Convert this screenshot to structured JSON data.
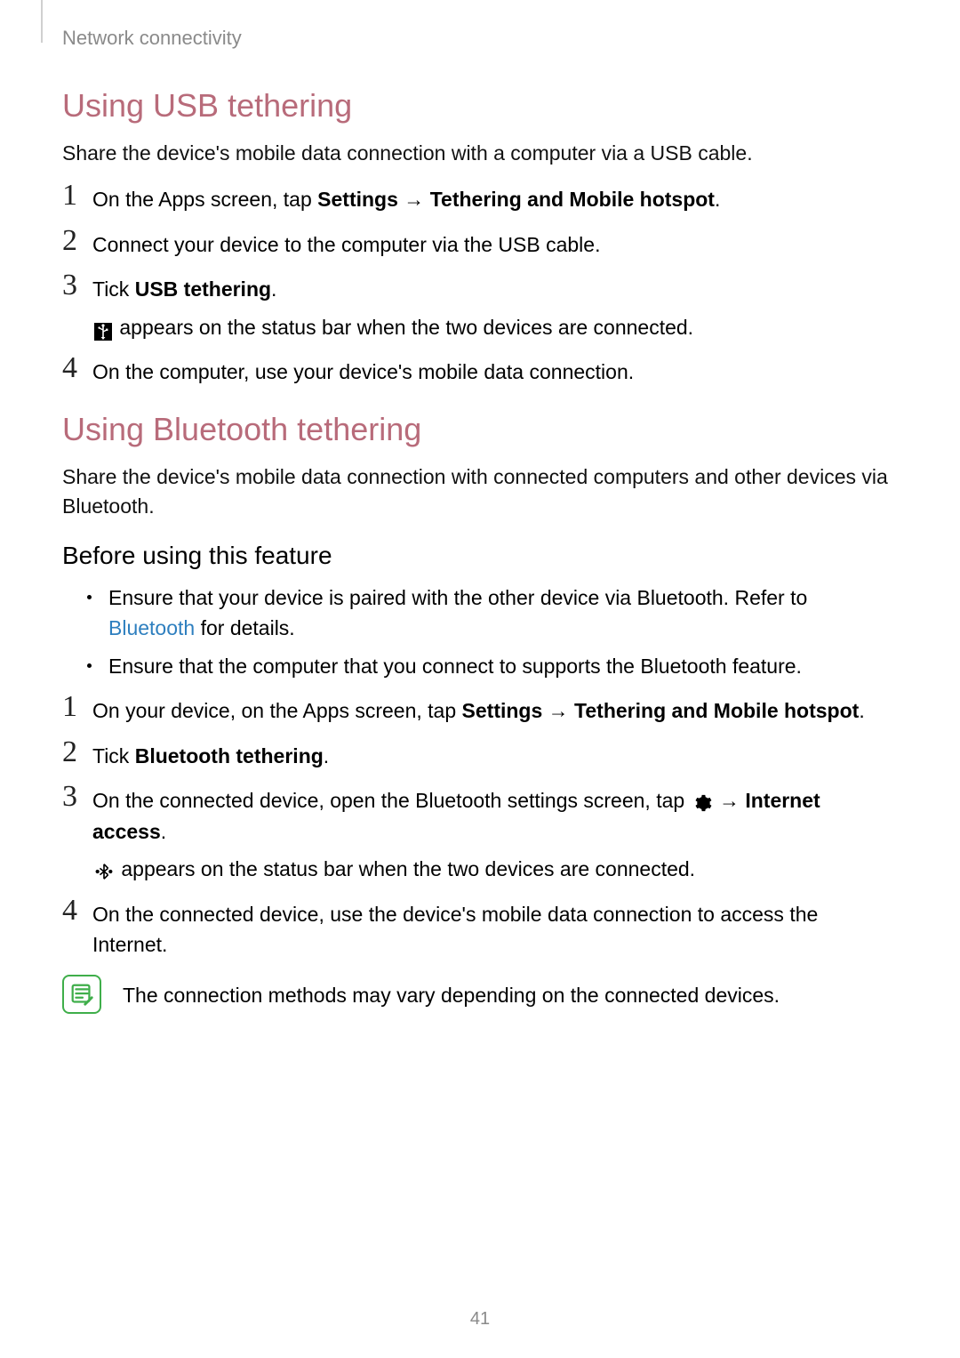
{
  "page_number": "41",
  "breadcrumb": "Network connectivity",
  "section_usb": {
    "heading": "Using USB tethering",
    "intro": "Share the device's mobile data connection with a computer via a USB cable.",
    "steps": {
      "s1": {
        "num": "1",
        "pre": "On the Apps screen, tap ",
        "b1": "Settings",
        "arrow": " → ",
        "b2": "Tethering and Mobile hotspot",
        "post": "."
      },
      "s2": {
        "num": "2",
        "text": "Connect your device to the computer via the USB cable."
      },
      "s3": {
        "num": "3",
        "pre": "Tick ",
        "b1": "USB tethering",
        "post": ".",
        "sub_post": " appears on the status bar when the two devices are connected."
      },
      "s4": {
        "num": "4",
        "text": "On the computer, use your device's mobile data connection."
      }
    }
  },
  "section_bt": {
    "heading": "Using Bluetooth tethering",
    "intro": "Share the device's mobile data connection with connected computers and other devices via Bluetooth.",
    "subheading": "Before using this feature",
    "bullets": {
      "b1": {
        "pre": "Ensure that your device is paired with the other device via Bluetooth. Refer to ",
        "link": "Bluetooth",
        "post": " for details."
      },
      "b2": {
        "text": "Ensure that the computer that you connect to supports the Bluetooth feature."
      }
    },
    "steps": {
      "s1": {
        "num": "1",
        "pre": "On your device, on the Apps screen, tap ",
        "b1": "Settings",
        "arrow": " → ",
        "b2": "Tethering and Mobile hotspot",
        "post": "."
      },
      "s2": {
        "num": "2",
        "pre": "Tick ",
        "b1": "Bluetooth tethering",
        "post": "."
      },
      "s3": {
        "num": "3",
        "pre": "On the connected device, open the Bluetooth settings screen, tap ",
        "arrow": " → ",
        "b1": "Internet access",
        "post": ".",
        "sub_post": " appears on the status bar when the two devices are connected."
      },
      "s4": {
        "num": "4",
        "text": "On the connected device, use the device's mobile data connection to access the Internet."
      }
    },
    "note": "The connection methods may vary depending on the connected devices."
  }
}
